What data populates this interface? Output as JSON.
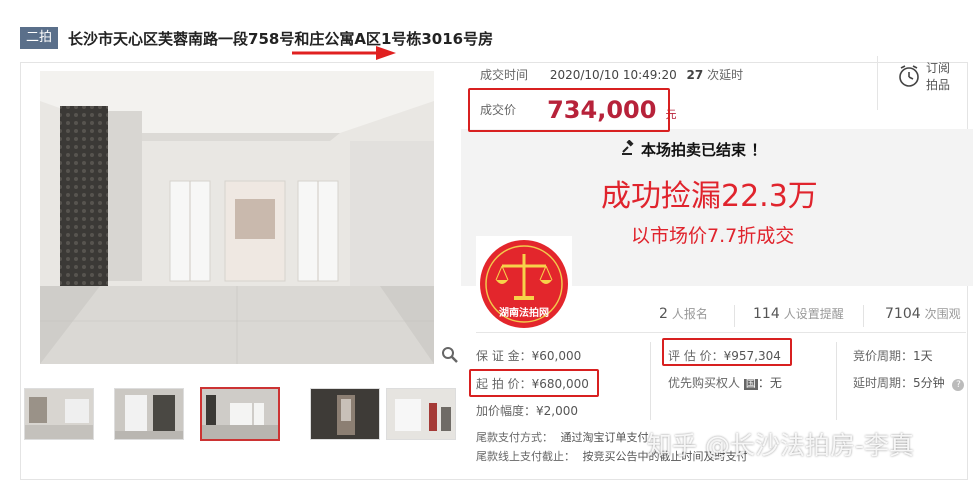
{
  "header": {
    "badge": "二拍",
    "title": "长沙市天心区芙蓉南路一段758号和庄公寓A区1号栋3016号房"
  },
  "deal": {
    "time_label": "成交时间",
    "time_value": "2020/10/10 10:49:20",
    "delay_count": "27",
    "delay_label": "次延时",
    "price_label": "成交价",
    "price_value": "734,000",
    "price_unit": "元"
  },
  "subscribe": {
    "line1": "订阅",
    "line2": "拍品"
  },
  "ended": {
    "notice": "本场拍卖已结束 ！",
    "headline": "成功捡漏22.3万",
    "subline": "以市场价7.7折成交"
  },
  "logo": {
    "text": "湖南法拍网"
  },
  "stats": {
    "signup_count": "2",
    "signup_label": "人报名",
    "remind_count": "114",
    "remind_label": "人设置提醒",
    "view_count": "7104",
    "view_label": "次围观"
  },
  "details": {
    "deposit_label": "保 证 金：",
    "deposit_value": "¥60,000",
    "appraisal_label": "评 估 价：",
    "appraisal_value": "¥957,304",
    "period_label": "竞价周期：",
    "period_value": "1天",
    "start_label": "起 拍 价：",
    "start_value": "¥680,000",
    "priority_label": "优先购买权人",
    "priority_tag": "国",
    "priority_value": "：无",
    "delay_label": "延时周期：",
    "delay_value": "5分钟",
    "increment_label": "加价幅度：",
    "increment_value": "¥2,000",
    "pay_method_label": "尾款支付方式：",
    "pay_method_value": "通过淘宝订单支付",
    "pay_deadline_label": "尾款线上支付截止：",
    "pay_deadline_value": "按竞买公告中的截止时间及时支付"
  },
  "watermark": "知乎 @长沙法拍房-李真",
  "colors": {
    "accent_red": "#e0242d",
    "price_red": "#b7223a",
    "badge_bg": "#5a6f8a"
  }
}
